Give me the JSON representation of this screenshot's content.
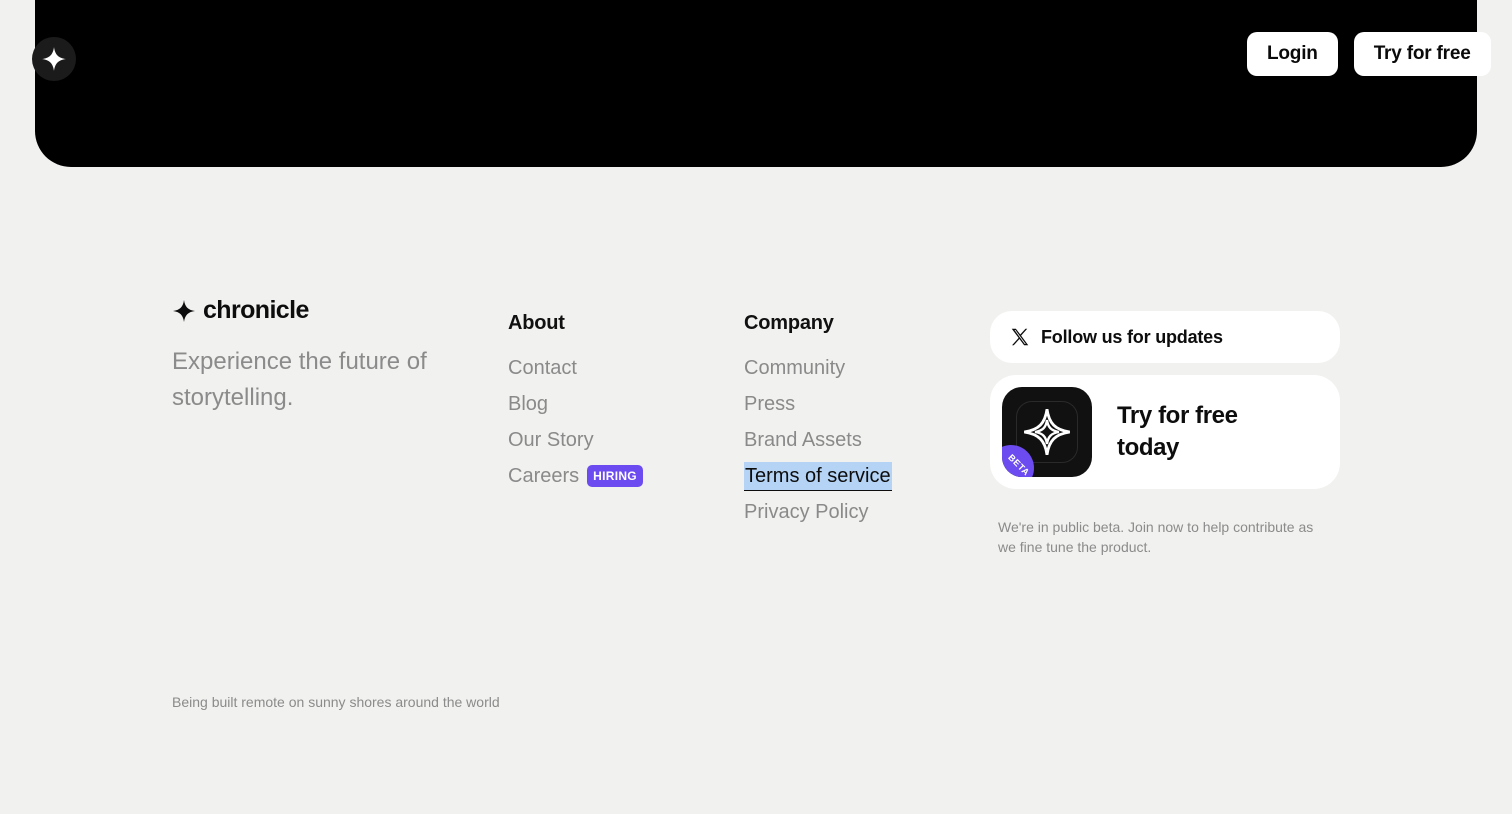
{
  "header": {
    "login_label": "Login",
    "try_label": "Try for free"
  },
  "footer": {
    "brand_name": "chronicle",
    "tagline": "Experience the future of storytelling.",
    "about": {
      "heading": "About",
      "links": [
        "Contact",
        "Blog",
        "Our Story",
        "Careers"
      ],
      "careers_badge": "HIRING"
    },
    "company": {
      "heading": "Company",
      "links": [
        "Community",
        "Press",
        "Brand Assets",
        "Terms of service",
        "Privacy Policy"
      ]
    },
    "follow_label": "Follow us for updates",
    "try_card_label": "Try for free today",
    "app_badge": "BETA",
    "beta_note": "We're in public beta. Join now to help contribute as we fine tune the product.",
    "bottom_note": "Being built remote on sunny shores around the world"
  },
  "colors": {
    "background": "#f1f1ef",
    "hero": "#000000",
    "accent_purple": "#6c4cf0",
    "selection_highlight": "#b4d3f5",
    "muted_text": "#8a8a8a"
  },
  "icons": {
    "brand": "sparkle-icon",
    "social": "x-logo-icon"
  }
}
